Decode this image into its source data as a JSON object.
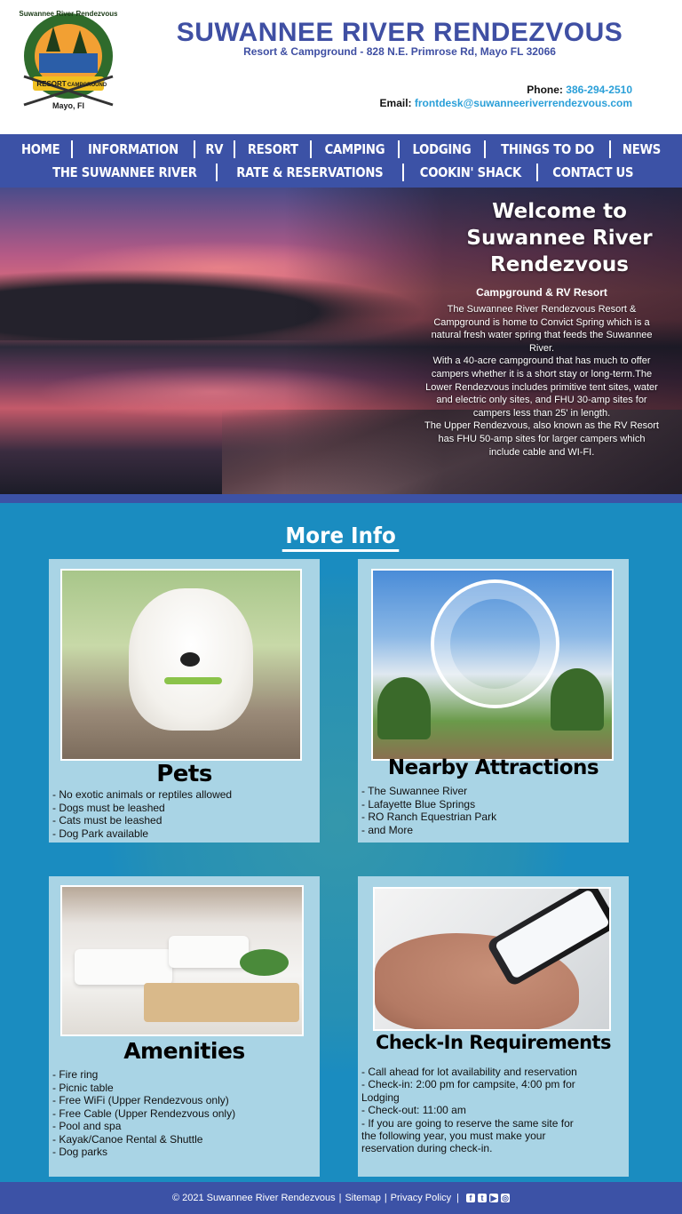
{
  "header": {
    "title": "SUWANNEE RIVER RENDEZVOUS",
    "subtitle": "Resort & Campground - 828 N.E. Primrose Rd, Mayo FL 32066",
    "phone_label": "Phone:",
    "phone": "386-294-2510",
    "email_label": "Email:",
    "email": "frontdesk@suwanneeriverrendezvous.com",
    "logo": {
      "top_text": "Suwannee River Rendezvous",
      "banner_left": "RESORT",
      "banner_right": "CAMPGROUND",
      "place": "Mayo, Fl"
    }
  },
  "nav": {
    "row1": [
      "HOME",
      "INFORMATION",
      "RV",
      "RESORT",
      "CAMPING",
      "LODGING",
      "THINGS TO DO",
      "NEWS"
    ],
    "row2": [
      "THE SUWANNEE RIVER",
      "RATE & RESERVATIONS",
      "COOKIN' SHACK",
      "CONTACT US"
    ]
  },
  "hero": {
    "heading_line1": "Welcome to",
    "heading_line2": "Suwannee River",
    "heading_line3": "Rendezvous",
    "subheading": "Campground & RV Resort",
    "para1": "The Suwannee River Rendezvous Resort & Campground is home to Convict Spring which is a natural fresh water spring that feeds the Suwannee River.",
    "para2": "With a 40-acre campground that has much to offer campers whether it is a short stay or long-term.The Lower Rendezvous includes primitive tent sites, water and electric only sites, and FHU 30-amp sites for campers less than 25' in length.",
    "para3": "The Upper Rendezvous, also known as the RV Resort has FHU 50-amp sites for larger campers which include cable and WI-FI."
  },
  "more_info": {
    "title": "More Info",
    "cards": [
      {
        "title": "Pets",
        "image": "puppy-photo",
        "items": [
          "- No exotic animals or reptiles allowed",
          "- Dogs must be leashed",
          "- Cats must be leashed",
          "- Dog Park available"
        ]
      },
      {
        "title": "Nearby Attractions",
        "image": "ferris-wheel-photo",
        "items": [
          "- The Suwannee River",
          "- Lafayette Blue Springs",
          "- RO Ranch Equestrian Park",
          "- and More"
        ]
      },
      {
        "title": "Amenities",
        "image": "hotel-bed-photo",
        "items": [
          "- Fire ring",
          "- Picnic table",
          "- Free WiFi (Upper Rendezvous only)",
          "- Free Cable (Upper Rendezvous only)",
          "- Pool and spa",
          "- Kayak/Canoe Rental & Shuttle",
          "- Dog parks"
        ]
      },
      {
        "title": "Check-In Requirements",
        "image": "phone-in-hand-photo",
        "items": [
          "- Call ahead for lot availability and reservation",
          "- Check-in: 2:00 pm for campsite, 4:00 pm for",
          "Lodging",
          "- Check-out: 11:00 am",
          "- If you are going to reserve the same site for",
          "the following year, you must make your",
          " reservation during check-in."
        ]
      }
    ]
  },
  "footer": {
    "copyright": "© 2021 Suwannee River Rendezvous",
    "sep": "|",
    "sitemap": "Sitemap",
    "privacy": "Privacy Policy",
    "social": [
      "facebook-icon",
      "twitter-icon",
      "youtube-icon",
      "instagram-icon"
    ]
  },
  "colors": {
    "brand_blue": "#3c52a6",
    "main_bg": "#1a8cc0",
    "card_bg": "#a9d4e5",
    "link": "#2a9fd8"
  }
}
